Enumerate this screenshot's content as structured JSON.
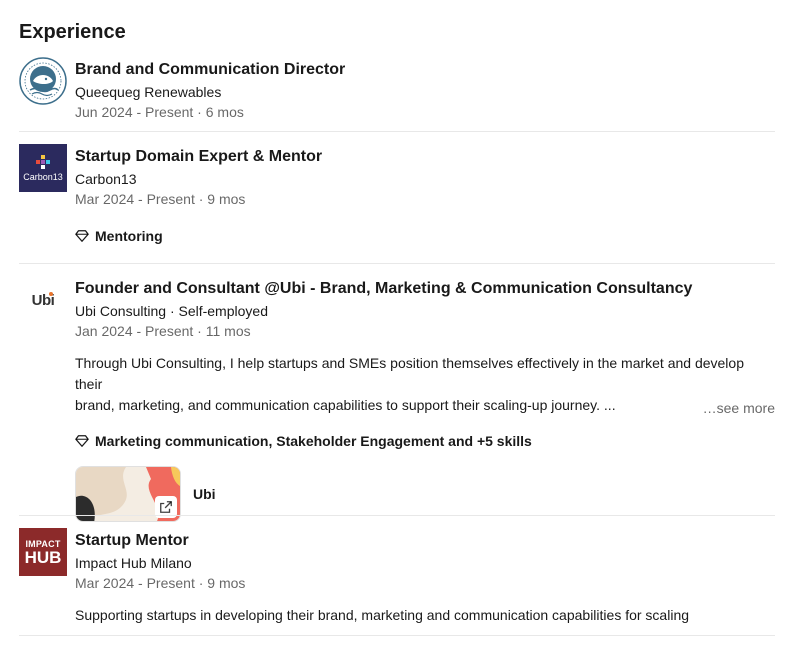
{
  "section": {
    "title": "Experience"
  },
  "experiences": [
    {
      "title": "Brand and Communication Director",
      "company": "Queequeg Renewables",
      "dates": "Jun 2024 - Present · 6 mos",
      "logo_icon": "queequeg-whale-logo"
    },
    {
      "title": "Startup Domain Expert & Mentor",
      "company": "Carbon13",
      "dates": "Mar 2024 - Present · 9 mos",
      "logo_text": "Carbon13",
      "skills": "Mentoring"
    },
    {
      "title": "Founder and Consultant @Ubi - Brand, Marketing & Communication Consultancy",
      "company": "Ubi Consulting · Self-employed",
      "dates": "Jan 2024 - Present · 11 mos",
      "logo_text": "Ubi",
      "description_line1": "Through Ubi Consulting, I help startups and SMEs position themselves effectively in the market and develop their",
      "description_line2": "brand, marketing, and communication capabilities to support their scaling-up journey. ...",
      "see_more": "…see more",
      "skills": "Marketing communication, Stakeholder Engagement and +5 skills",
      "media_label": "Ubi"
    },
    {
      "title": "Startup Mentor",
      "company": "Impact Hub Milano",
      "dates": "Mar 2024 - Present · 9 mos",
      "logo_line1": "IMPACT",
      "logo_line2": "HUB",
      "description": "Supporting startups in developing their brand, marketing and communication capabilities for scaling"
    }
  ],
  "colors": {
    "carbon13_bg": "#2b2a5e",
    "impact_hub_bg": "#8c2a2a",
    "queequeg_blue": "#3d6f8c",
    "ubi_orange": "#e8742c",
    "secondary_text": "#666666",
    "divider": "#e8e8e8"
  }
}
